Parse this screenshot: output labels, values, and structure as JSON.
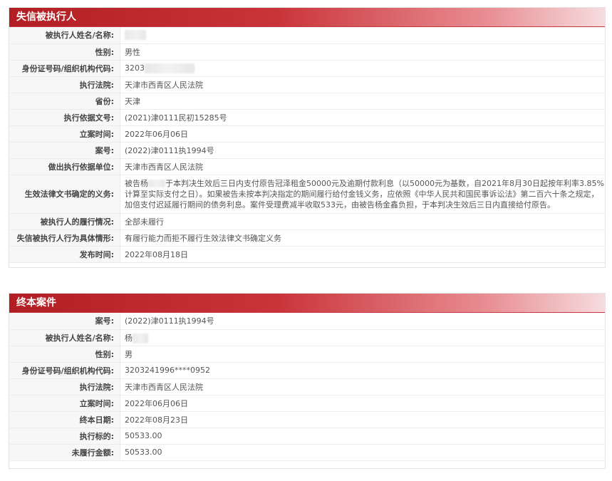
{
  "section1": {
    "title": "失信被执行人",
    "rows": [
      {
        "label": "被执行人姓名/名称:",
        "value": ""
      },
      {
        "label": "性别:",
        "value": "男性"
      },
      {
        "label": "身份证号码/组织机构代码:",
        "value": "3203"
      },
      {
        "label": "执行法院:",
        "value": "天津市西青区人民法院"
      },
      {
        "label": "省份:",
        "value": "天津"
      },
      {
        "label": "执行依据文号:",
        "value": "(2021)津0111民初15285号"
      },
      {
        "label": "立案时间:",
        "value": "2022年06月06日"
      },
      {
        "label": "案号:",
        "value": "(2022)津0111执1994号"
      },
      {
        "label": "做出执行依据单位:",
        "value": "天津市西青区人民法院"
      },
      {
        "label": "生效法律文书确定的义务:",
        "value_prefix": "被告杨",
        "value": "于本判决生效后三日内支付原告冠泽租金50000元及逾期付款利息（以50000元为基数，自2021年8月30日起按年利率3.85%计算至实际支付之日）。如果被告未按本判决指定的期间履行给付金钱义务，应依照《中华人民共和国民事诉讼法》第二百六十条之规定，加倍支付迟延履行期间的债务利息。案件受理费减半收取533元，由被告杨金鑫负担，于本判决生效后三日内直接给付原告。"
      },
      {
        "label": "被执行人的履行情况:",
        "value": "全部未履行"
      },
      {
        "label": "失信被执行人行为具体情形:",
        "value": "有履行能力而拒不履行生效法律文书确定义务"
      },
      {
        "label": "发布时间:",
        "value": "2022年08月18日"
      }
    ]
  },
  "section2": {
    "title": "终本案件",
    "rows": [
      {
        "label": "案号:",
        "value": "(2022)津0111执1994号"
      },
      {
        "label": "被执行人姓名/名称:",
        "value": "杨"
      },
      {
        "label": "性别:",
        "value": "男"
      },
      {
        "label": "身份证号码/组织机构代码:",
        "value": "3203241996****0952"
      },
      {
        "label": "执行法院:",
        "value": "天津市西青区人民法院"
      },
      {
        "label": "立案时间:",
        "value": "2022年06月06日"
      },
      {
        "label": "终本日期:",
        "value": "2022年08月23日"
      },
      {
        "label": "执行标的:",
        "value": "50533.00"
      },
      {
        "label": "未履行金额:",
        "value": "50533.00"
      }
    ]
  }
}
